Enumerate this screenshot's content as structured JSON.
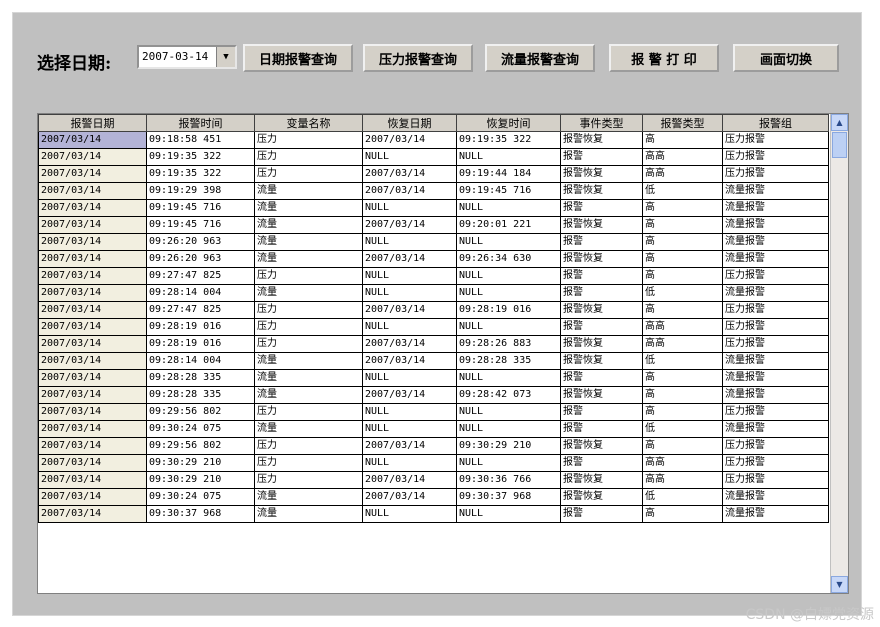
{
  "toolbar": {
    "date_label": "选择日期:",
    "date_value": "2007-03-14",
    "btn_date_query": "日期报警查询",
    "btn_pressure_query": "压力报警查询",
    "btn_flow_query": "流量报警查询",
    "btn_print": "报 警 打 印",
    "btn_switch": "画面切换"
  },
  "table": {
    "headers": [
      "报警日期",
      "报警时间",
      "变量名称",
      "恢复日期",
      "恢复时间",
      "事件类型",
      "报警类型",
      "报警组"
    ],
    "rows": [
      [
        "2007/03/14",
        "09:18:58  451",
        "压力",
        "2007/03/14",
        "09:19:35  322",
        "报警恢复",
        "高",
        "压力报警"
      ],
      [
        "2007/03/14",
        "09:19:35  322",
        "压力",
        "NULL",
        "NULL",
        "报警",
        "高高",
        "压力报警"
      ],
      [
        "2007/03/14",
        "09:19:35  322",
        "压力",
        "2007/03/14",
        "09:19:44  184",
        "报警恢复",
        "高高",
        "压力报警"
      ],
      [
        "2007/03/14",
        "09:19:29  398",
        "流量",
        "2007/03/14",
        "09:19:45  716",
        "报警恢复",
        "低",
        "流量报警"
      ],
      [
        "2007/03/14",
        "09:19:45  716",
        "流量",
        "NULL",
        "NULL",
        "报警",
        "高",
        "流量报警"
      ],
      [
        "2007/03/14",
        "09:19:45  716",
        "流量",
        "2007/03/14",
        "09:20:01  221",
        "报警恢复",
        "高",
        "流量报警"
      ],
      [
        "2007/03/14",
        "09:26:20  963",
        "流量",
        "NULL",
        "NULL",
        "报警",
        "高",
        "流量报警"
      ],
      [
        "2007/03/14",
        "09:26:20  963",
        "流量",
        "2007/03/14",
        "09:26:34  630",
        "报警恢复",
        "高",
        "流量报警"
      ],
      [
        "2007/03/14",
        "09:27:47  825",
        "压力",
        "NULL",
        "NULL",
        "报警",
        "高",
        "压力报警"
      ],
      [
        "2007/03/14",
        "09:28:14  004",
        "流量",
        "NULL",
        "NULL",
        "报警",
        "低",
        "流量报警"
      ],
      [
        "2007/03/14",
        "09:27:47  825",
        "压力",
        "2007/03/14",
        "09:28:19  016",
        "报警恢复",
        "高",
        "压力报警"
      ],
      [
        "2007/03/14",
        "09:28:19  016",
        "压力",
        "NULL",
        "NULL",
        "报警",
        "高高",
        "压力报警"
      ],
      [
        "2007/03/14",
        "09:28:19  016",
        "压力",
        "2007/03/14",
        "09:28:26  883",
        "报警恢复",
        "高高",
        "压力报警"
      ],
      [
        "2007/03/14",
        "09:28:14  004",
        "流量",
        "2007/03/14",
        "09:28:28  335",
        "报警恢复",
        "低",
        "流量报警"
      ],
      [
        "2007/03/14",
        "09:28:28  335",
        "流量",
        "NULL",
        "NULL",
        "报警",
        "高",
        "流量报警"
      ],
      [
        "2007/03/14",
        "09:28:28  335",
        "流量",
        "2007/03/14",
        "09:28:42  073",
        "报警恢复",
        "高",
        "流量报警"
      ],
      [
        "2007/03/14",
        "09:29:56  802",
        "压力",
        "NULL",
        "NULL",
        "报警",
        "高",
        "压力报警"
      ],
      [
        "2007/03/14",
        "09:30:24  075",
        "流量",
        "NULL",
        "NULL",
        "报警",
        "低",
        "流量报警"
      ],
      [
        "2007/03/14",
        "09:29:56  802",
        "压力",
        "2007/03/14",
        "09:30:29  210",
        "报警恢复",
        "高",
        "压力报警"
      ],
      [
        "2007/03/14",
        "09:30:29  210",
        "压力",
        "NULL",
        "NULL",
        "报警",
        "高高",
        "压力报警"
      ],
      [
        "2007/03/14",
        "09:30:29  210",
        "压力",
        "2007/03/14",
        "09:30:36  766",
        "报警恢复",
        "高高",
        "压力报警"
      ],
      [
        "2007/03/14",
        "09:30:24  075",
        "流量",
        "2007/03/14",
        "09:30:37  968",
        "报警恢复",
        "低",
        "流量报警"
      ],
      [
        "2007/03/14",
        "09:30:37  968",
        "流量",
        "NULL",
        "NULL",
        "报警",
        "高",
        "流量报警"
      ]
    ]
  },
  "watermark": "CSDN @白嫖党资源"
}
